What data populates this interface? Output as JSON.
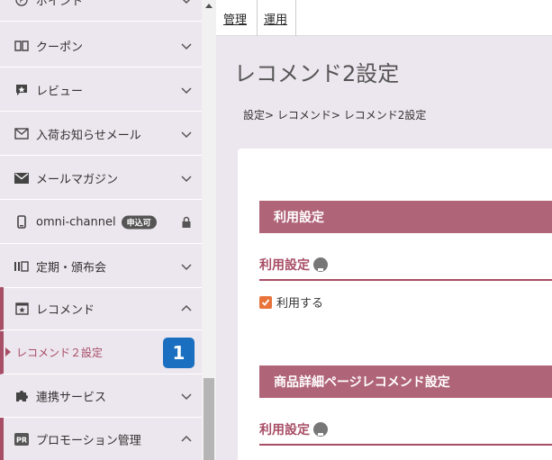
{
  "sidebar": {
    "items": [
      {
        "label": "ポイント",
        "icon": "point-icon"
      },
      {
        "label": "クーポン",
        "icon": "coupon-icon"
      },
      {
        "label": "レビュー",
        "icon": "review-icon"
      },
      {
        "label": "入荷お知らせメール",
        "icon": "mail-icon"
      },
      {
        "label": "メールマガジン",
        "icon": "envelope-icon"
      },
      {
        "label": "omni-channel",
        "badge": "申込可",
        "icon": "phone-icon",
        "lock": "lock-icon"
      },
      {
        "label": "定期・頒布会",
        "icon": "subscription-icon"
      },
      {
        "label": "レコメンド",
        "icon": "recommend-icon"
      },
      {
        "label": "連携サービス",
        "icon": "puzzle-icon"
      },
      {
        "label": "プロモーション管理",
        "icon": "pr-icon",
        "icon_text": "PR"
      }
    ],
    "sub_item": {
      "label": "レコメンド２設定"
    },
    "step_badge": "1"
  },
  "top_menu": {
    "tabs": [
      {
        "label": "管理"
      },
      {
        "label": "運用"
      }
    ]
  },
  "main": {
    "title": "レコメンド2設定",
    "breadcrumb": "設定> レコメンド> レコメンド2設定",
    "sections": [
      {
        "heading": "利用設定",
        "field_label": "利用設定",
        "checkbox_label": "利用する",
        "checked": true
      },
      {
        "heading": "商品詳細ページレコメンド設定",
        "field_label": "利用設定"
      }
    ]
  },
  "colors": {
    "sidebar_bg": "#ece6ee",
    "accent": "#a84e66",
    "section_header": "#b06478",
    "checkbox": "#e8743b",
    "step_badge": "#1a6fc0"
  }
}
